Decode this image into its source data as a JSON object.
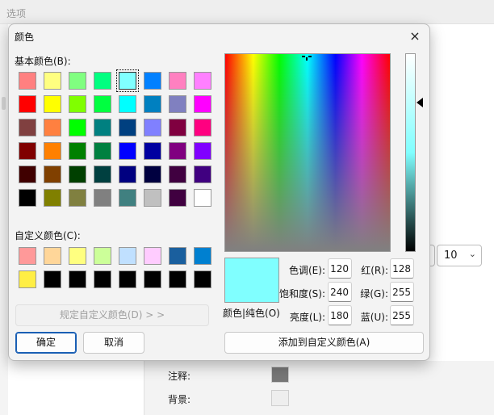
{
  "background_window": {
    "title": "选项",
    "size_value": "10",
    "note_label": "注释:",
    "note_color": "#777777",
    "background_label": "背景:",
    "background_color": "#eeeeee"
  },
  "dialog": {
    "title": "颜色",
    "close_icon": "×",
    "basic_colors_label": "基本颜色(B):",
    "basic_colors": [
      [
        "#ff8080",
        "#ffff80",
        "#80ff80",
        "#00ff80",
        "#80ffff",
        "#0080ff",
        "#ff80c0",
        "#ff80ff"
      ],
      [
        "#ff0000",
        "#ffff00",
        "#80ff00",
        "#00ff40",
        "#00ffff",
        "#0080c0",
        "#8080c0",
        "#ff00ff"
      ],
      [
        "#804040",
        "#ff8040",
        "#00ff00",
        "#008080",
        "#004080",
        "#8080ff",
        "#800040",
        "#ff0080"
      ],
      [
        "#800000",
        "#ff8000",
        "#008000",
        "#008040",
        "#0000ff",
        "#0000a0",
        "#800080",
        "#8000ff"
      ],
      [
        "#400000",
        "#804000",
        "#004000",
        "#004040",
        "#000080",
        "#000040",
        "#400040",
        "#400080"
      ],
      [
        "#000000",
        "#808000",
        "#808040",
        "#808080",
        "#408080",
        "#c0c0c0",
        "#400040",
        "#ffffff"
      ]
    ],
    "selected_basic": "#80ffff",
    "custom_colors_label": "自定义颜色(C):",
    "custom_colors": [
      [
        "#ff9999",
        "#ffd699",
        "#ffff80",
        "#ccff99",
        "#c0e0ff",
        "#ffccff",
        "#1a5f9e",
        "#0080d0"
      ],
      [
        "#ffee44",
        "#000000",
        "#000000",
        "#000000",
        "#000000",
        "#000000",
        "#000000",
        "#000000"
      ]
    ],
    "define_custom_button": "规定自定义颜色(D) > >",
    "ok_button": "确定",
    "cancel_button": "取消",
    "preview_color": "#80ffff",
    "preview_label": "颜色|纯色(O)",
    "hue_label": "色调(E):",
    "hue": "120",
    "sat_label": "饱和度(S):",
    "sat": "240",
    "lum_label": "亮度(L):",
    "lum": "180",
    "red_label": "红(R):",
    "red": "128",
    "green_label": "绿(G):",
    "green": "255",
    "blue_label": "蓝(U):",
    "blue": "255",
    "add_custom_button": "添加到自定义颜色(A)"
  }
}
